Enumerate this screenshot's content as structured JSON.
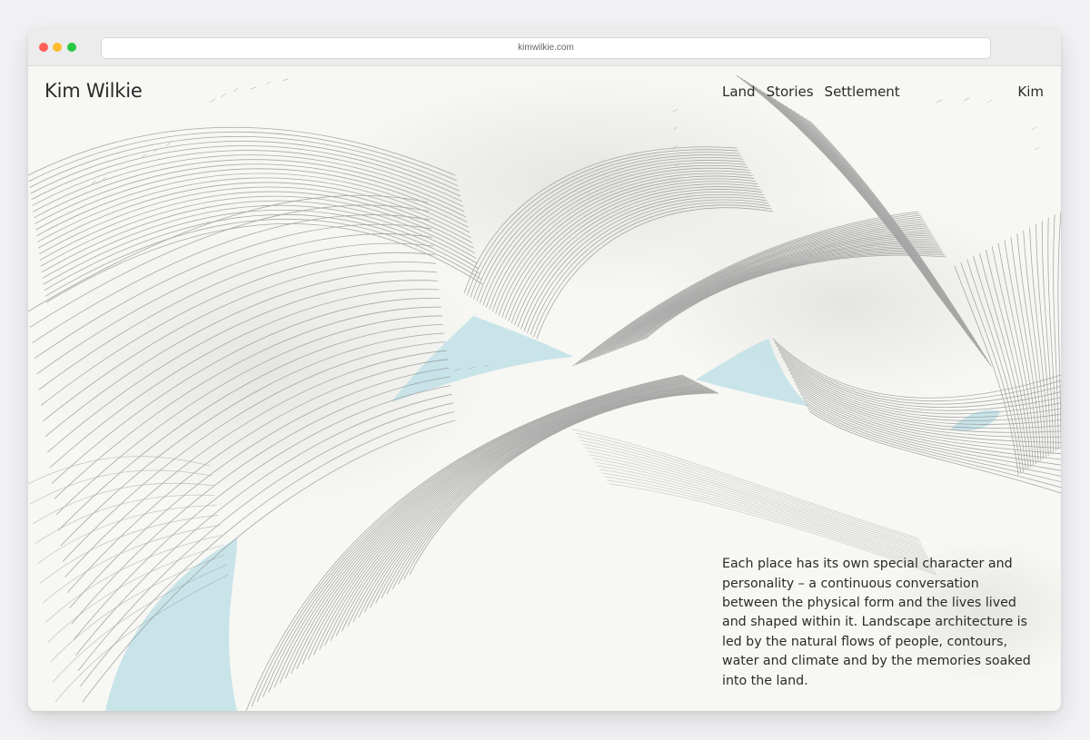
{
  "browser": {
    "url": "kimwilkie.com"
  },
  "site": {
    "brand": "Kim Wilkie",
    "nav": [
      "Land",
      "Stories",
      "Settlement"
    ],
    "nav_right": "Kim",
    "intro": "Each place has its own special character and personality – a continuous conversation between the physical form and the lives lived and shaped within it. Landscape architecture is led by the natural flows of people, contours, water and climate and by the memories soaked into the land."
  },
  "colors": {
    "water": "#bfe0e6",
    "pencil": "#8c8c8c",
    "paper": "#f7f7f4",
    "text": "#2a2a2a"
  }
}
